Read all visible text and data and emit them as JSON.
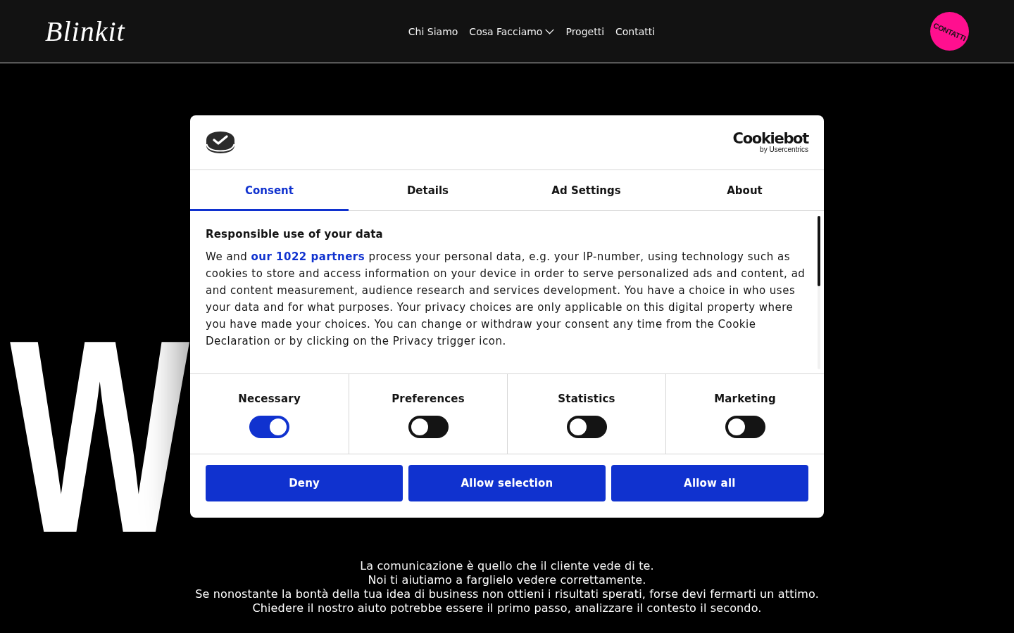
{
  "header": {
    "logo": "Blinkit",
    "nav": [
      {
        "label": "Chi Siamo",
        "kind": "link"
      },
      {
        "label": "Cosa Facciamo",
        "kind": "dropdown"
      },
      {
        "label": "Progetti",
        "kind": "link"
      },
      {
        "label": "Contatti",
        "kind": "link"
      }
    ],
    "cta": "CONTATTI"
  },
  "hero": {
    "heading": "W",
    "intro_lines": [
      "La comunicazione è quello che il cliente vede di te.",
      "Noi ti aiutiamo a farglielo vedere correttamente.",
      "Se nonostante la bontà della tua idea di business non ottieni i risultati sperati, forse devi fermarti un attimo.",
      "Chiedere il nostro aiuto potrebbe essere il primo passo, analizzare il contesto il secondo."
    ]
  },
  "cookie_dialog": {
    "brand": {
      "name": "Cookiebot",
      "byline": "by Usercentrics"
    },
    "tabs": [
      {
        "label": "Consent",
        "selected": true
      },
      {
        "label": "Details",
        "selected": false
      },
      {
        "label": "Ad Settings",
        "selected": false
      },
      {
        "label": "About",
        "selected": false
      }
    ],
    "heading": "Responsible use of your data",
    "body": {
      "before": "We and",
      "link": "our 1022 partners",
      "after": "process your personal data, e.g. your IP-number, using technology such as cookies to store and access information on your device in order to serve personalized ads and content, ad and content measurement, audience research and services development. You have a choice in who uses your data and for what purposes. Your privacy choices are only applicable on this digital property where you have made your choices. You can change or withdraw your consent any time from the Cookie Declaration or by clicking on the Privacy trigger icon."
    },
    "categories": [
      {
        "label": "Necessary",
        "checked": true
      },
      {
        "label": "Preferences",
        "checked": false
      },
      {
        "label": "Statistics",
        "checked": false
      },
      {
        "label": "Marketing",
        "checked": false
      }
    ],
    "buttons": [
      "Deny",
      "Allow selection",
      "Allow all"
    ]
  }
}
